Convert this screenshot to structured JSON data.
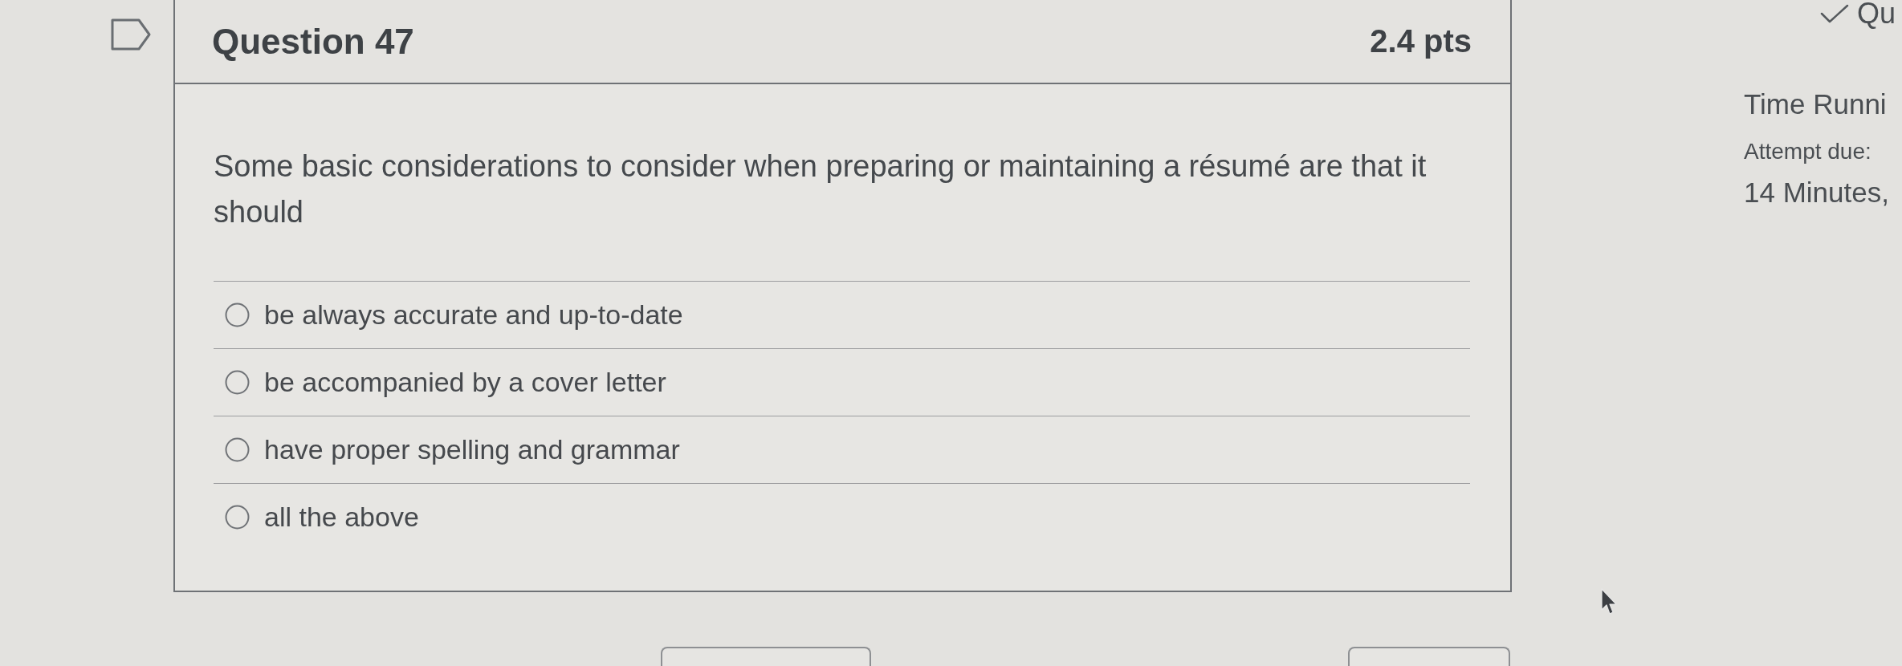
{
  "question": {
    "flagged": false,
    "title": "Question 47",
    "points": "2.4 pts",
    "text": "Some basic considerations to consider when preparing or maintaining a résumé are that it should",
    "answers": [
      {
        "label": "be always accurate and up-to-date",
        "selected": false
      },
      {
        "label": "be accompanied by a cover letter",
        "selected": false
      },
      {
        "label": "have proper spelling and grammar",
        "selected": false
      },
      {
        "label": "all the above",
        "selected": false
      }
    ]
  },
  "sidebar": {
    "heading": "Qu",
    "timer_label": "Time Runni",
    "attempt_due": "Attempt due:",
    "time_remaining": "14 Minutes,"
  }
}
